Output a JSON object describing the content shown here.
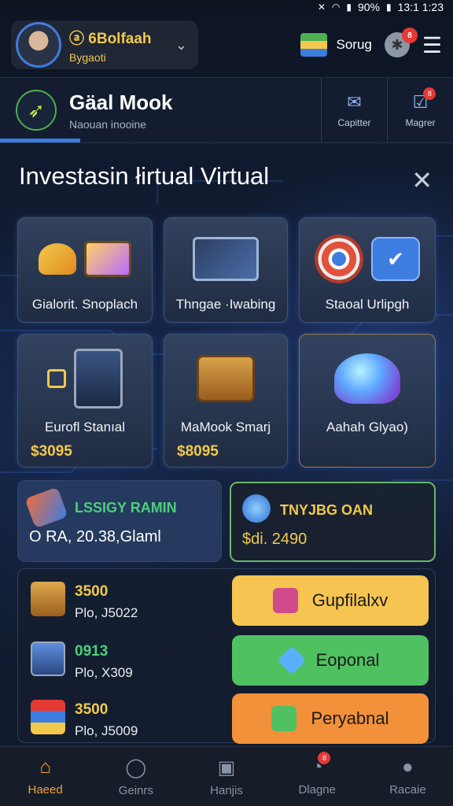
{
  "status": {
    "pct": "90%",
    "time": "13:1 1:23"
  },
  "profile": {
    "name": "ⓐ 6Bolfaah",
    "sub": "Bygaoti"
  },
  "toolbar": {
    "shop_label": "Sorug",
    "notif_badge": "8"
  },
  "header": {
    "title": "Gäal Mook",
    "subtitle": "Naouan inooine",
    "btn1": "Capitter",
    "btn2": "Magrer",
    "btn2_badge": "8"
  },
  "modal": {
    "title": "Investasin łirtual Virtual"
  },
  "cards": [
    {
      "label": "Gialorit. Snoplach"
    },
    {
      "label": "Thngae ·Iwabing"
    },
    {
      "label": "Staoal Urlipgh"
    },
    {
      "label": "Eurofl Stanıal",
      "price": "$3095"
    },
    {
      "label": "MaMook Smarj",
      "price": "$8095"
    },
    {
      "label": "Aahah Glyao)"
    }
  ],
  "stats": [
    {
      "head": "LSSIGY RAMIN",
      "value": "O RA, 20.38,Glaml"
    },
    {
      "head": "TNYJBG OAN",
      "value": "$di. 2490"
    }
  ],
  "rows": [
    {
      "value": "3500",
      "sub": "Plo, J5022",
      "button": "Gupfilalxv",
      "color": "#f5c451"
    },
    {
      "value": "0913",
      "sub": "Plo, X309",
      "button": "Eoponal",
      "color": "#4fc161"
    },
    {
      "value": "3500",
      "sub": "Plo, J5009",
      "button": "Peryabnal",
      "color": "#f2913a"
    }
  ],
  "nav": [
    {
      "label": "Haeed",
      "icon": "home-icon",
      "active": true
    },
    {
      "label": "Geinrs",
      "icon": "search-icon"
    },
    {
      "label": "Hanjis",
      "icon": "chart-icon"
    },
    {
      "label": "Dlagne",
      "icon": "bell-icon",
      "badge": "8"
    },
    {
      "label": "Racaie",
      "icon": "user-icon"
    }
  ],
  "colors": {
    "accent": "#f2c94c",
    "primary": "#3d7de0",
    "background": "#0f1726"
  }
}
